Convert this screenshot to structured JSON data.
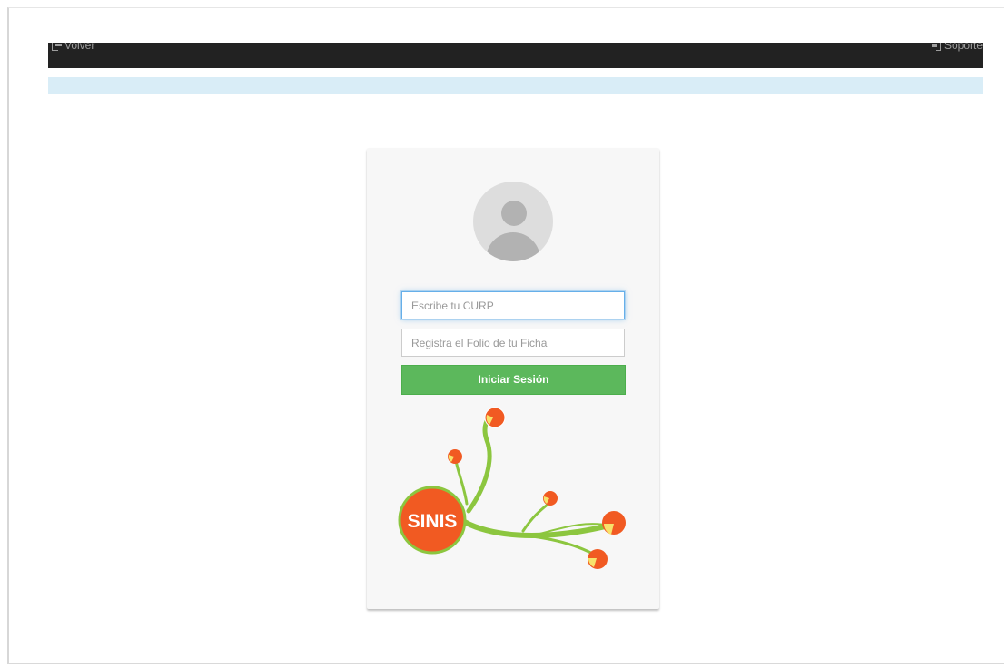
{
  "nav": {
    "back_label": "Volver",
    "support_label": "Soporte"
  },
  "login": {
    "curp_placeholder": "Escribe tu CURP",
    "folio_placeholder": "Registra el Folio de tu Ficha",
    "submit_label": "Iniciar Sesión"
  },
  "logo": {
    "text": "SINIS"
  },
  "colors": {
    "navbar": "#222222",
    "alert": "#d9edf7",
    "button": "#5cb85c",
    "logo_orange": "#f15a22",
    "logo_green": "#8cc63f"
  },
  "icons": {
    "back": "sign-out-icon",
    "support": "sign-in-icon",
    "avatar": "user-avatar-icon"
  }
}
